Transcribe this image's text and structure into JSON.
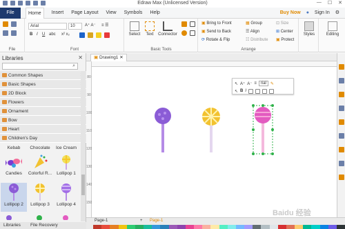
{
  "window": {
    "title": "Edraw Max (Unlicensed Version)",
    "min": "—",
    "max": "☐",
    "close": "✕"
  },
  "menu": {
    "file": "File",
    "items": [
      "Home",
      "Insert",
      "Page Layout",
      "View",
      "Symbols",
      "Help"
    ],
    "right": {
      "buy": "Buy Now",
      "sign_in": "Sign In",
      "sign_in_icon": "user-icon",
      "extra": "✕"
    }
  },
  "ribbon": {
    "file_group_label": "File",
    "font": {
      "family": "Arial",
      "size": "10",
      "label": "Font"
    },
    "basic_tools": {
      "select": "Select",
      "text": "Text",
      "connector": "Connector",
      "label": "Basic Tools"
    },
    "arrange": {
      "bring_to_front": "Bring to Front",
      "send_to_back": "Send to Back",
      "rotate_flip": "Rotate & Flip",
      "group": "Group",
      "align": "Align",
      "distribute": "Distribute",
      "size": "Size",
      "center": "Center",
      "protect": "Protect",
      "label": "Arrange"
    },
    "styles": "Styles",
    "editing": "Editing"
  },
  "libraries": {
    "title": "Libraries",
    "close": "✕",
    "search_placeholder": "",
    "categories": [
      "Common Shapes",
      "Basic Shapes",
      "2D Block",
      "Flowers",
      "Ornament",
      "Bow",
      "Heart",
      "Children's Day"
    ],
    "shapes": [
      [
        "Kebab",
        "Chocolate",
        "Ice Cream"
      ],
      [
        "Candies",
        "Colorful R...",
        "Lollipop 1"
      ],
      [
        "Lollipop 2",
        "Lollipop 3",
        "Lollipop 4"
      ]
    ],
    "tabs": {
      "libraries": "Libraries",
      "file_recovery": "File Recovery"
    }
  },
  "document": {
    "tab": "Drawing1",
    "ruler_v": [
      "80",
      "90",
      "100",
      "110",
      "120",
      "130",
      "140",
      "150"
    ]
  },
  "mini_toolbar": {
    "font": "rial"
  },
  "statusbar": {
    "page_left": "Page-1",
    "add": "+",
    "page_active": "Page-1"
  },
  "watermark": "Baidu 经验",
  "colors": {
    "file_tab": "#1e3a6e",
    "buy_now": "#e08a00",
    "lollipop_purple": "#8b5cd6",
    "lollipop_yellow": "#f2c230",
    "lollipop_pink": "#e35bc0"
  }
}
